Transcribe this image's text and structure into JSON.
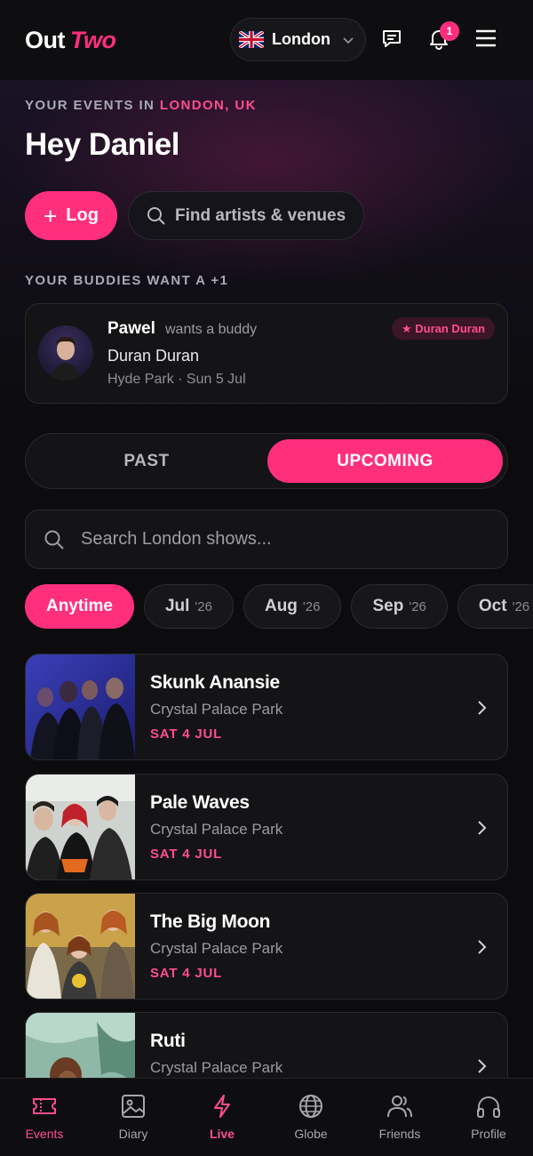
{
  "header": {
    "logo_out": "Out",
    "logo_two": "Two",
    "city": "London",
    "notification_count": "1"
  },
  "hero": {
    "label_prefix": "YOUR EVENTS IN",
    "label_city": "LONDON, UK",
    "greeting": "Hey Daniel",
    "log_button": "Log",
    "find_placeholder": "Find artists & venues"
  },
  "buddies": {
    "section_label": "YOUR BUDDIES WANT A +1",
    "name": "Pawel",
    "wants": "wants a buddy",
    "artist": "Duran Duran",
    "meta": "Hyde Park · Sun 5 Jul",
    "tag": "★ Duran Duran"
  },
  "toggle": {
    "past": "PAST",
    "upcoming": "UPCOMING",
    "selected": "upcoming"
  },
  "search": {
    "placeholder": "Search London shows..."
  },
  "chips": [
    {
      "label": "Anytime",
      "year": "",
      "active": true
    },
    {
      "label": "Jul",
      "year": "'26",
      "active": false
    },
    {
      "label": "Aug",
      "year": "'26",
      "active": false
    },
    {
      "label": "Sep",
      "year": "'26",
      "active": false
    },
    {
      "label": "Oct",
      "year": "'26",
      "active": false
    }
  ],
  "events": [
    {
      "title": "Skunk Anansie",
      "venue": "Crystal Palace Park",
      "date": "SAT 4 JUL"
    },
    {
      "title": "Pale Waves",
      "venue": "Crystal Palace Park",
      "date": "SAT 4 JUL"
    },
    {
      "title": "The Big Moon",
      "venue": "Crystal Palace Park",
      "date": "SAT 4 JUL"
    },
    {
      "title": "Ruti",
      "venue": "Crystal Palace Park",
      "date": ""
    }
  ],
  "nav": [
    {
      "label": "Events",
      "icon": "ticket-icon",
      "active": true
    },
    {
      "label": "Diary",
      "icon": "image-icon",
      "active": false
    },
    {
      "label": "Live",
      "icon": "lightning-icon",
      "active": false
    },
    {
      "label": "Globe",
      "icon": "globe-icon",
      "active": false
    },
    {
      "label": "Friends",
      "icon": "users-icon",
      "active": false
    },
    {
      "label": "Profile",
      "icon": "headphones-icon",
      "active": false
    }
  ],
  "colors": {
    "accent": "#ff2f7e",
    "accent_text": "#ff4d8f",
    "background": "#0c0c0e",
    "card": "#141416"
  }
}
